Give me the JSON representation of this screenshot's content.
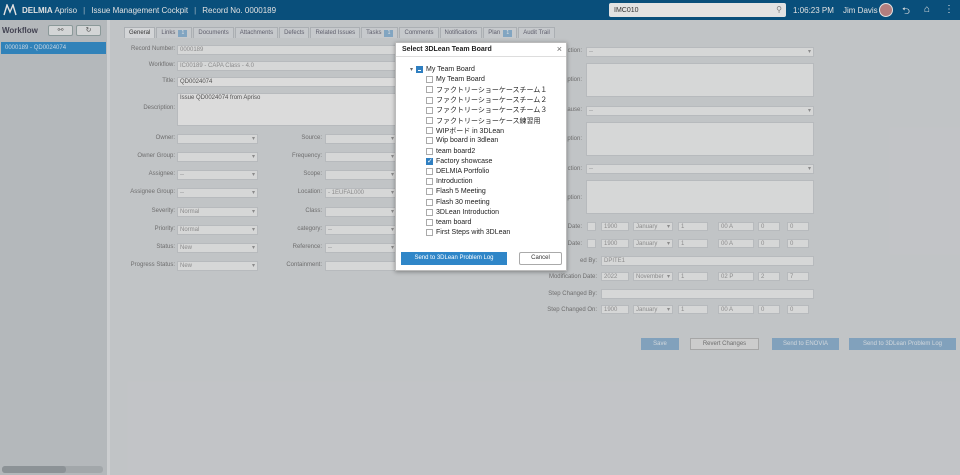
{
  "topbar": {
    "brand_bold": "DELMIA",
    "brand_rest": " Apriso",
    "separator": "|",
    "breadcrumb_1": "Issue Management Cockpit",
    "breadcrumb_2": "Record No. 0000189",
    "search_value": "IMC010",
    "time": "1:06:23 PM",
    "user": "Jim Davis"
  },
  "left": {
    "title": "Workflow",
    "item": "0000189 - QD0024074"
  },
  "tabs": [
    {
      "label": "General",
      "badge": ""
    },
    {
      "label": "Links",
      "badge": "1"
    },
    {
      "label": "Documents",
      "badge": ""
    },
    {
      "label": "Attachments",
      "badge": ""
    },
    {
      "label": "Defects",
      "badge": ""
    },
    {
      "label": "Related Issues",
      "badge": ""
    },
    {
      "label": "Tasks",
      "badge": "1"
    },
    {
      "label": "Comments",
      "badge": ""
    },
    {
      "label": "Notifications",
      "badge": ""
    },
    {
      "label": "Plan",
      "badge": "1"
    },
    {
      "label": "Audit Trail",
      "badge": ""
    }
  ],
  "form": {
    "record_number_label": "Record Number:",
    "record_number": "0000189",
    "workflow_label": "Workflow:",
    "workflow": "IC00189 - CAPA Class - 4.0",
    "title_label": "Title:",
    "title": "QD0024074",
    "description_label": "Description:",
    "description": "Issue QD0024074 from Apriso",
    "owner_label": "Owner:",
    "owner_group_label": "Owner Group:",
    "assignee_label": "Assignee:",
    "assignee": "--",
    "assignee_group_label": "Assignee Group:",
    "assignee_group": "--",
    "severity_label": "Severity:",
    "severity": "Normal",
    "priority_label": "Priority:",
    "priority": "Normal",
    "status_label": "Status:",
    "status": "New",
    "progress_status_label": "Progress Status:",
    "progress_status": "New",
    "source_label": "Source:",
    "frequency_label": "Frequency:",
    "scope_label": "Scope:",
    "location_label": "Location:",
    "location": "- 1EUFAL000",
    "class_label": "Class:",
    "category_label": "category:",
    "category": "--",
    "reference_label": "Reference:",
    "reference": "--",
    "containment_label": "Containment:",
    "r_action_1_label": "ction:",
    "r_action_1": "--",
    "r_desc_1_label": "ption:",
    "r_cause_label": "ause:",
    "r_cause": "--",
    "r_desc_2_label": "ption:",
    "r_action_2_label": "ction:",
    "r_action_2": "--",
    "r_desc_3_label": "ption:",
    "date1_label": "Date:",
    "date2_label": "Date:",
    "year": "1900",
    "month": "January",
    "day": "1",
    "hour": "00 A",
    "minute": "0",
    "second": "0",
    "changed_by_label": "ed By:",
    "changed_by": "DPITE1",
    "mod_date_label": "Modification Date:",
    "mod_year": "2022",
    "mod_month": "November",
    "mod_day": "1",
    "mod_hour": "02 P",
    "mod_minute": "2",
    "mod_second": "7",
    "step_changed_by_label": "Step Changed By:",
    "step_changed_on_label": "Step Changed On:",
    "step_year": "1900",
    "step_month": "January",
    "step_day": "1",
    "step_hour": "00 A",
    "step_minute": "0",
    "step_second": "0"
  },
  "buttons": {
    "save": "Save",
    "revert": "Revert Changes",
    "send_enovia": "Send to ENOVIA",
    "send_3dlean": "Send to 3DLean Problem Log"
  },
  "modal": {
    "title": "Select 3DLean Team Board",
    "close": "×",
    "root_label": "My Team Board",
    "items": [
      {
        "label": "My Team Board",
        "checked": false
      },
      {
        "label": "ファクトリーショーケースチーム１",
        "checked": false
      },
      {
        "label": "ファクトリーショーケースチーム２",
        "checked": false
      },
      {
        "label": "ファクトリーショーケースチーム３",
        "checked": false
      },
      {
        "label": "ファクトリーショーケース練習用",
        "checked": false
      },
      {
        "label": "WIPボード in 3DLean",
        "checked": false
      },
      {
        "label": "Wip board in 3dlean",
        "checked": false
      },
      {
        "label": "team board2",
        "checked": false
      },
      {
        "label": "Factory showcase",
        "checked": true
      },
      {
        "label": "DELMIA Portfolio",
        "checked": false
      },
      {
        "label": "Introduction",
        "checked": false
      },
      {
        "label": "Flash 5 Meeting",
        "checked": false
      },
      {
        "label": "Flash 30 meeting",
        "checked": false
      },
      {
        "label": "3DLean Introduction",
        "checked": false
      },
      {
        "label": "team board",
        "checked": false
      },
      {
        "label": "First Steps with 3DLean",
        "checked": false
      }
    ],
    "send_label": "Send to 3DLean Problem Log",
    "cancel_label": "Cancel"
  }
}
